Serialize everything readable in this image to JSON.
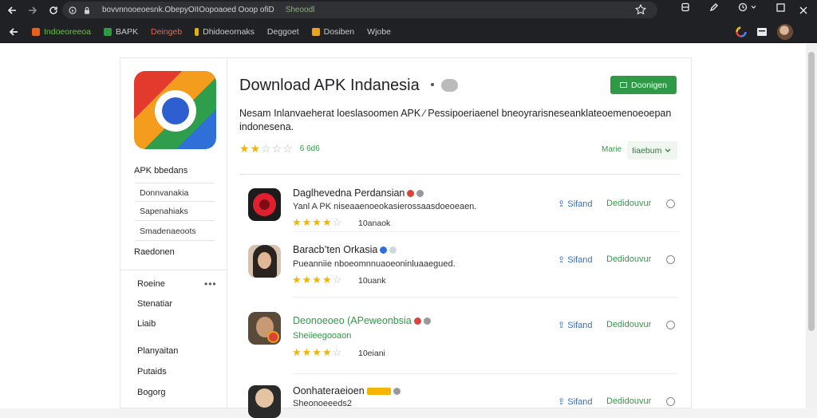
{
  "browser": {
    "url": "bovvnnooeoesnk.ObepyOIIOopoaoed Ooop ofiD",
    "url_tail": "Sheoodl",
    "bookmarks": [
      {
        "label": "Indoeoreeoa",
        "color": "#e8611a",
        "text_color": "#6fbf4a"
      },
      {
        "label": "BAPK",
        "color": "#2f9a45"
      },
      {
        "label": "Deingeb",
        "color": "#d94a2e",
        "text_color": "#e06a52"
      },
      {
        "label": "Dhidoeornaks",
        "color": "#d9b21a"
      },
      {
        "label": "Deggoet",
        "color": ""
      },
      {
        "label": "Dosiben",
        "color": "#e8a41a"
      },
      {
        "label": "Wjobe",
        "color": ""
      }
    ]
  },
  "sidebar": {
    "title": "APK bbedans",
    "boxes": [
      "Donnvanakia",
      "Sapenahiaks",
      "Smadenaeoots"
    ],
    "after_label": "Raedonen",
    "links": [
      "Roeine",
      "Stenatiar",
      "Liaib",
      "Planyaitan",
      "Putaids",
      "Bogorg"
    ]
  },
  "main": {
    "title": "Download APK Indanesia",
    "download_label": "Doonigen",
    "description": "Nesam Inlanvaeherat loeslasoomen APK ∕ Pessipoeriaenel bneoyrarisneseanklateoemenoeoepan indonesena.",
    "rating_score": "6 6d6",
    "sort_label": "Marie",
    "sort_value": "Iiaebum"
  },
  "apps": [
    {
      "name": "Daglhevedna Perdansian",
      "description": "Yanl A PK  niseaaenoeokasierossaasdoeoeaen.",
      "count": "10anaok",
      "share": "Sifand",
      "download": "Dedidouvur",
      "name_color": "default"
    },
    {
      "name": "Baracb’ten Orkasia",
      "description": "Pueanniie nboeomnnuaoeoninluaaegued.",
      "count": "10uank",
      "share": "Sifand",
      "download": "Dedidouvur",
      "name_color": "default"
    },
    {
      "name": "Deonoeoeo (APeweonbsia",
      "description": "Sheiieegooaon",
      "count": "10eiani",
      "share": "Sifand",
      "download": "Dedidouvur",
      "name_color": "green"
    },
    {
      "name": "Oonhateraeioen",
      "description": "Sheonoeeeds2",
      "count": "",
      "share": "Sifand",
      "download": "Dedidouvur",
      "name_color": "default"
    }
  ],
  "icons": {
    "back": "arrow-left-icon",
    "forward": "arrow-right-icon",
    "reload": "reload-icon",
    "bookmark_star": "star-icon",
    "info": "info-icon"
  },
  "colors": {
    "accent_green": "#2f9a45",
    "link_blue": "#2f6fd8",
    "star_yellow": "#f4b400"
  },
  "ratings": {
    "main": 2.5,
    "apps": [
      4,
      4,
      4
    ]
  }
}
